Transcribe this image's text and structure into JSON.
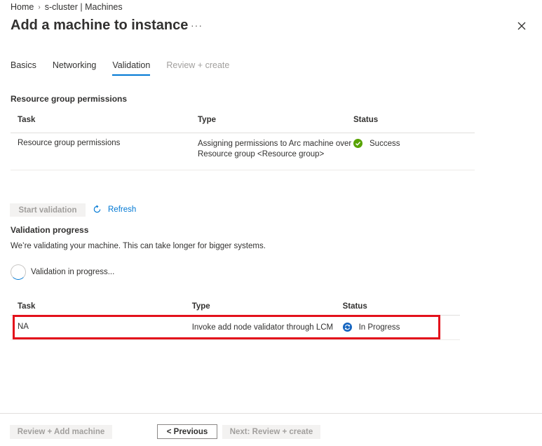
{
  "breadcrumb": {
    "home": "Home",
    "current": "s-cluster | Machines"
  },
  "header": {
    "title": "Add a machine to instance",
    "more": "···"
  },
  "tabs": [
    {
      "label": "Basics"
    },
    {
      "label": "Networking"
    },
    {
      "label": "Validation"
    },
    {
      "label": "Review + create"
    }
  ],
  "permissions": {
    "title": "Resource group permissions",
    "headers": {
      "task": "Task",
      "type": "Type",
      "status": "Status"
    },
    "rows": [
      {
        "task": "Resource group permissions",
        "type_line1": "Assigning permissions to Arc machine over",
        "type_line2": "Resource group <Resource group>",
        "status": "Success"
      }
    ]
  },
  "actions": {
    "start_validation": "Start validation",
    "refresh": "Refresh"
  },
  "validation": {
    "title": "Validation progress",
    "description": "We’re validating your machine. This can take longer for bigger systems.",
    "progress_text": "Validation in progress...",
    "headers": {
      "task": "Task",
      "type": "Type",
      "status": "Status"
    },
    "rows": [
      {
        "task": "NA",
        "type": "Invoke add node validator through LCM",
        "status": "In Progress"
      }
    ]
  },
  "footer": {
    "review_add": "Review + Add machine",
    "previous": "< Previous",
    "next": "Next: Review + create"
  },
  "colors": {
    "accent": "#0078d4",
    "success": "#57a300",
    "highlight": "#e3111b"
  }
}
